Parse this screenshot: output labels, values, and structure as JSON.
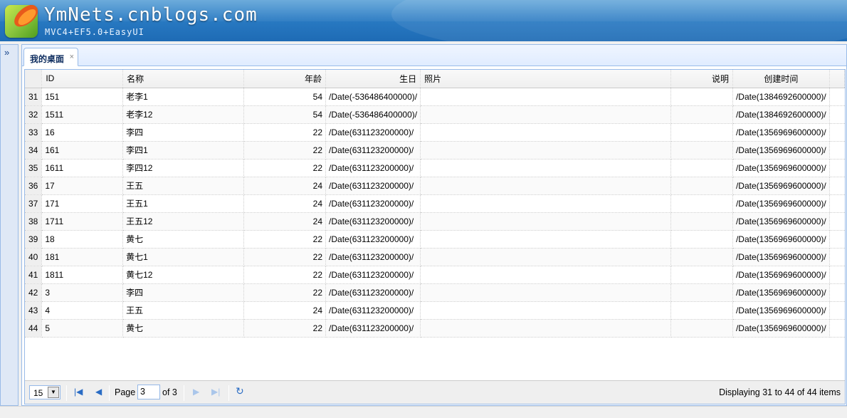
{
  "header": {
    "title": "YmNets.cnblogs.com",
    "subtitle": "MVC4+EF5.0+EasyUI"
  },
  "west": {
    "expand_icon": "»"
  },
  "tabs": [
    {
      "label": "我的桌面",
      "close": "×"
    }
  ],
  "grid": {
    "columns": [
      "ID",
      "名称",
      "年龄",
      "生日",
      "照片",
      "说明",
      "创建时间"
    ],
    "rows": [
      {
        "rn": "31",
        "id": "151",
        "name": "老李1",
        "age": "54",
        "birthday": "/Date(-536486400000)/",
        "photo": "",
        "desc": "",
        "created": "/Date(1384692600000)/"
      },
      {
        "rn": "32",
        "id": "1511",
        "name": "老李12",
        "age": "54",
        "birthday": "/Date(-536486400000)/",
        "photo": "",
        "desc": "",
        "created": "/Date(1384692600000)/"
      },
      {
        "rn": "33",
        "id": "16",
        "name": "李四",
        "age": "22",
        "birthday": "/Date(631123200000)/",
        "photo": "",
        "desc": "",
        "created": "/Date(1356969600000)/"
      },
      {
        "rn": "34",
        "id": "161",
        "name": "李四1",
        "age": "22",
        "birthday": "/Date(631123200000)/",
        "photo": "",
        "desc": "",
        "created": "/Date(1356969600000)/"
      },
      {
        "rn": "35",
        "id": "1611",
        "name": "李四12",
        "age": "22",
        "birthday": "/Date(631123200000)/",
        "photo": "",
        "desc": "",
        "created": "/Date(1356969600000)/"
      },
      {
        "rn": "36",
        "id": "17",
        "name": "王五",
        "age": "24",
        "birthday": "/Date(631123200000)/",
        "photo": "",
        "desc": "",
        "created": "/Date(1356969600000)/"
      },
      {
        "rn": "37",
        "id": "171",
        "name": "王五1",
        "age": "24",
        "birthday": "/Date(631123200000)/",
        "photo": "",
        "desc": "",
        "created": "/Date(1356969600000)/"
      },
      {
        "rn": "38",
        "id": "1711",
        "name": "王五12",
        "age": "24",
        "birthday": "/Date(631123200000)/",
        "photo": "",
        "desc": "",
        "created": "/Date(1356969600000)/"
      },
      {
        "rn": "39",
        "id": "18",
        "name": "黄七",
        "age": "22",
        "birthday": "/Date(631123200000)/",
        "photo": "",
        "desc": "",
        "created": "/Date(1356969600000)/"
      },
      {
        "rn": "40",
        "id": "181",
        "name": "黄七1",
        "age": "22",
        "birthday": "/Date(631123200000)/",
        "photo": "",
        "desc": "",
        "created": "/Date(1356969600000)/"
      },
      {
        "rn": "41",
        "id": "1811",
        "name": "黄七12",
        "age": "22",
        "birthday": "/Date(631123200000)/",
        "photo": "",
        "desc": "",
        "created": "/Date(1356969600000)/"
      },
      {
        "rn": "42",
        "id": "3",
        "name": "李四",
        "age": "22",
        "birthday": "/Date(631123200000)/",
        "photo": "",
        "desc": "",
        "created": "/Date(1356969600000)/"
      },
      {
        "rn": "43",
        "id": "4",
        "name": "王五",
        "age": "24",
        "birthday": "/Date(631123200000)/",
        "photo": "",
        "desc": "",
        "created": "/Date(1356969600000)/"
      },
      {
        "rn": "44",
        "id": "5",
        "name": "黄七",
        "age": "22",
        "birthday": "/Date(631123200000)/",
        "photo": "",
        "desc": "",
        "created": "/Date(1356969600000)/"
      }
    ]
  },
  "pager": {
    "page_size": "15",
    "page_label": "Page",
    "page_number": "3",
    "of_label": "of 3",
    "info": "Displaying 31 to 44 of 44 items"
  }
}
